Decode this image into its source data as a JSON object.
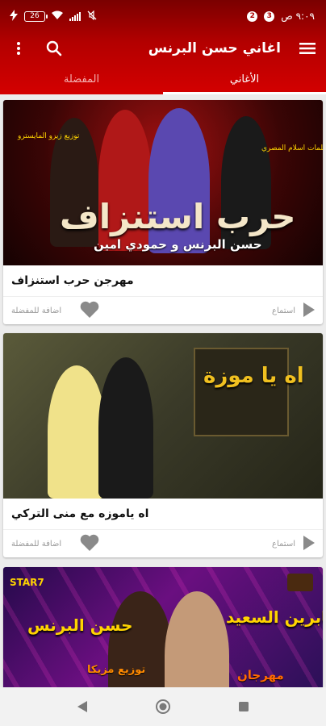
{
  "status_bar": {
    "time": "٩:٠٩ ص",
    "badge_1": "2",
    "badge_2": "3",
    "battery": "26",
    "network_icons": [
      "wifi-icon",
      "signal-icon",
      "mute-icon"
    ]
  },
  "app_bar": {
    "title": "اغاني حسن البرنس"
  },
  "tabs": [
    {
      "label": "الأغاني",
      "active": true
    },
    {
      "label": "المفضلة",
      "active": false
    }
  ],
  "cards": [
    {
      "title": "مهرجن حرب استنزاف",
      "listen_label": "استماع",
      "favorite_label": "اضافة للمفضلة",
      "art": {
        "headline": "حرب استنزاف",
        "credits": "حسن البرنس و حمودي امين",
        "tag_left": "توزيع زيزو المايسترو",
        "tag_right": "كلمات اسلام المصري"
      }
    },
    {
      "title": "اه ياموزه مع منى التركي",
      "listen_label": "استماع",
      "favorite_label": "اضافة للمفضلة",
      "art": {
        "headline": "اه يا موزة"
      }
    },
    {
      "title": "",
      "listen_label": "",
      "favorite_label": "",
      "art": {
        "name_left": "حسن البرنس",
        "name_right": "صابرين السعيد",
        "badge": "STAR7",
        "caption": "توزيع مزيكا",
        "sub_right": "مهرجان"
      }
    }
  ],
  "colors": {
    "header_top": "#7a0000",
    "header_bottom": "#d40000",
    "accent_text": "#ffd400"
  }
}
